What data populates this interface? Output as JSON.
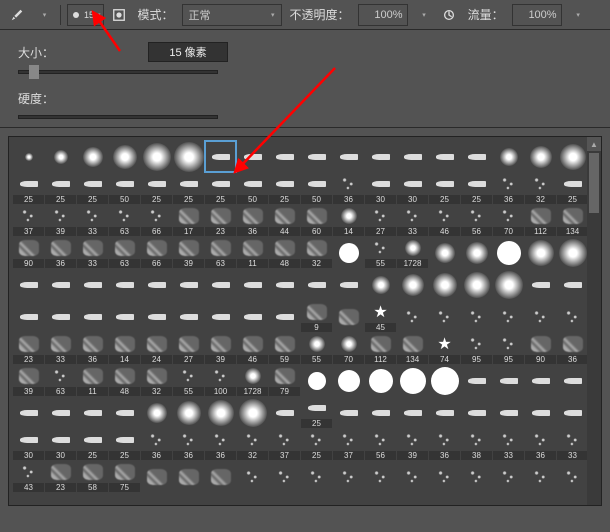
{
  "toolbar": {
    "brush_size_value": "15",
    "mode_label": "模式：",
    "mode_value": "正常",
    "opacity_label": "不透明度：",
    "opacity_value": "100%",
    "flow_label": "流量：",
    "flow_value": "100%"
  },
  "panel": {
    "size_label": "大小：",
    "size_value": "15 像素",
    "hardness_label": "硬度："
  },
  "brushes": [
    {
      "label": "",
      "type": "soft-round",
      "size": 8
    },
    {
      "label": "",
      "type": "soft-round",
      "size": 14
    },
    {
      "label": "",
      "type": "soft-round",
      "size": 20
    },
    {
      "label": "",
      "type": "soft-round",
      "size": 24
    },
    {
      "label": "",
      "type": "soft-round",
      "size": 28
    },
    {
      "label": "",
      "type": "soft-round",
      "size": 30
    },
    {
      "label": "",
      "type": "stroke-shape",
      "size": 14,
      "selected": true
    },
    {
      "label": "",
      "type": "stroke-shape",
      "size": 16
    },
    {
      "label": "",
      "type": "stroke-shape",
      "size": 14
    },
    {
      "label": "",
      "type": "stroke-shape",
      "size": 12
    },
    {
      "label": "",
      "type": "stroke-shape",
      "size": 14
    },
    {
      "label": "",
      "type": "stroke-shape",
      "size": 14
    },
    {
      "label": "",
      "type": "stroke-shape",
      "size": 10
    },
    {
      "label": "",
      "type": "stroke-shape",
      "size": 12
    },
    {
      "label": "",
      "type": "stroke-shape",
      "size": 10
    },
    {
      "label": "",
      "type": "soft-round",
      "size": 18
    },
    {
      "label": "",
      "type": "soft-round",
      "size": 22
    },
    {
      "label": "",
      "type": "soft-round",
      "size": 26
    },
    {
      "label": "25",
      "type": "stroke-shape"
    },
    {
      "label": "25",
      "type": "stroke-shape"
    },
    {
      "label": "25",
      "type": "stroke-shape"
    },
    {
      "label": "50",
      "type": "stroke-shape"
    },
    {
      "label": "25",
      "type": "stroke-shape"
    },
    {
      "label": "25",
      "type": "stroke-shape"
    },
    {
      "label": "25",
      "type": "stroke-shape"
    },
    {
      "label": "50",
      "type": "stroke-shape"
    },
    {
      "label": "25",
      "type": "stroke-shape"
    },
    {
      "label": "50",
      "type": "stroke-shape"
    },
    {
      "label": "36",
      "type": "spatter"
    },
    {
      "label": "30",
      "type": "stroke-shape"
    },
    {
      "label": "30",
      "type": "stroke-shape"
    },
    {
      "label": "25",
      "type": "stroke-shape"
    },
    {
      "label": "25",
      "type": "stroke-shape"
    },
    {
      "label": "36",
      "type": "spatter"
    },
    {
      "label": "32",
      "type": "spatter"
    },
    {
      "label": "25",
      "type": "stroke-shape"
    },
    {
      "label": "37",
      "type": "spatter"
    },
    {
      "label": "39",
      "type": "spatter"
    },
    {
      "label": "33",
      "type": "spatter"
    },
    {
      "label": "63",
      "type": "spatter"
    },
    {
      "label": "66",
      "type": "spatter"
    },
    {
      "label": "17",
      "type": "chalk"
    },
    {
      "label": "23",
      "type": "chalk"
    },
    {
      "label": "36",
      "type": "chalk"
    },
    {
      "label": "44",
      "type": "chalk"
    },
    {
      "label": "60",
      "type": "chalk"
    },
    {
      "label": "14",
      "type": "soft-round"
    },
    {
      "label": "27",
      "type": "spatter"
    },
    {
      "label": "33",
      "type": "spatter"
    },
    {
      "label": "46",
      "type": "spatter"
    },
    {
      "label": "56",
      "type": "spatter"
    },
    {
      "label": "70",
      "type": "spatter"
    },
    {
      "label": "112",
      "type": "chalk"
    },
    {
      "label": "134",
      "type": "chalk"
    },
    {
      "label": "90",
      "type": "chalk"
    },
    {
      "label": "36",
      "type": "chalk"
    },
    {
      "label": "33",
      "type": "chalk"
    },
    {
      "label": "63",
      "type": "chalk"
    },
    {
      "label": "66",
      "type": "chalk"
    },
    {
      "label": "39",
      "type": "chalk"
    },
    {
      "label": "63",
      "type": "chalk"
    },
    {
      "label": "11",
      "type": "chalk"
    },
    {
      "label": "48",
      "type": "chalk"
    },
    {
      "label": "32",
      "type": "chalk"
    },
    {
      "label": "",
      "type": "hard-round",
      "size": 20
    },
    {
      "label": "55",
      "type": "spatter"
    },
    {
      "label": "1728",
      "type": "soft-round"
    },
    {
      "label": "",
      "type": "soft-round",
      "size": 20
    },
    {
      "label": "",
      "type": "soft-round",
      "size": 22
    },
    {
      "label": "",
      "type": "hard-round",
      "size": 24
    },
    {
      "label": "",
      "type": "soft-round",
      "size": 26
    },
    {
      "label": "",
      "type": "soft-round",
      "size": 28
    },
    {
      "label": "",
      "type": "stroke-shape"
    },
    {
      "label": "",
      "type": "stroke-shape"
    },
    {
      "label": "",
      "type": "stroke-shape"
    },
    {
      "label": "",
      "type": "stroke-shape"
    },
    {
      "label": "",
      "type": "stroke-shape"
    },
    {
      "label": "",
      "type": "stroke-shape"
    },
    {
      "label": "",
      "type": "stroke-shape"
    },
    {
      "label": "",
      "type": "stroke-shape"
    },
    {
      "label": "",
      "type": "stroke-shape"
    },
    {
      "label": "",
      "type": "stroke-shape"
    },
    {
      "label": "",
      "type": "stroke-shape"
    },
    {
      "label": "",
      "type": "soft-round",
      "size": 18
    },
    {
      "label": "",
      "type": "soft-round",
      "size": 22
    },
    {
      "label": "",
      "type": "soft-round",
      "size": 24
    },
    {
      "label": "",
      "type": "soft-round",
      "size": 26
    },
    {
      "label": "",
      "type": "soft-round",
      "size": 28
    },
    {
      "label": "",
      "type": "stroke-shape"
    },
    {
      "label": "",
      "type": "stroke-shape"
    },
    {
      "label": "",
      "type": "stroke-shape"
    },
    {
      "label": "",
      "type": "stroke-shape"
    },
    {
      "label": "",
      "type": "stroke-shape"
    },
    {
      "label": "",
      "type": "stroke-shape"
    },
    {
      "label": "",
      "type": "stroke-shape"
    },
    {
      "label": "",
      "type": "stroke-shape"
    },
    {
      "label": "",
      "type": "stroke-shape"
    },
    {
      "label": "",
      "type": "stroke-shape"
    },
    {
      "label": "",
      "type": "stroke-shape"
    },
    {
      "label": "9",
      "type": "chalk"
    },
    {
      "label": "",
      "type": "chalk"
    },
    {
      "label": "45",
      "type": "star"
    },
    {
      "label": "",
      "type": "spatter"
    },
    {
      "label": "",
      "type": "spatter"
    },
    {
      "label": "",
      "type": "spatter"
    },
    {
      "label": "",
      "type": "spatter"
    },
    {
      "label": "",
      "type": "spatter"
    },
    {
      "label": "",
      "type": "spatter"
    },
    {
      "label": "23",
      "type": "chalk"
    },
    {
      "label": "33",
      "type": "chalk"
    },
    {
      "label": "36",
      "type": "chalk"
    },
    {
      "label": "14",
      "type": "chalk"
    },
    {
      "label": "24",
      "type": "chalk"
    },
    {
      "label": "27",
      "type": "chalk"
    },
    {
      "label": "39",
      "type": "chalk"
    },
    {
      "label": "46",
      "type": "chalk"
    },
    {
      "label": "59",
      "type": "chalk"
    },
    {
      "label": "55",
      "type": "soft-round"
    },
    {
      "label": "70",
      "type": "soft-round"
    },
    {
      "label": "112",
      "type": "chalk"
    },
    {
      "label": "134",
      "type": "chalk"
    },
    {
      "label": "74",
      "type": "star"
    },
    {
      "label": "95",
      "type": "spatter"
    },
    {
      "label": "95",
      "type": "spatter"
    },
    {
      "label": "90",
      "type": "chalk"
    },
    {
      "label": "36",
      "type": "chalk"
    },
    {
      "label": "39",
      "type": "chalk"
    },
    {
      "label": "63",
      "type": "spatter"
    },
    {
      "label": "11",
      "type": "chalk"
    },
    {
      "label": "48",
      "type": "chalk"
    },
    {
      "label": "32",
      "type": "chalk"
    },
    {
      "label": "55",
      "type": "spatter"
    },
    {
      "label": "100",
      "type": "spatter"
    },
    {
      "label": "1728",
      "type": "soft-round"
    },
    {
      "label": "79",
      "type": "chalk"
    },
    {
      "label": "",
      "type": "hard-round",
      "size": 18
    },
    {
      "label": "",
      "type": "hard-round",
      "size": 22
    },
    {
      "label": "",
      "type": "hard-round",
      "size": 24
    },
    {
      "label": "",
      "type": "hard-round",
      "size": 26
    },
    {
      "label": "",
      "type": "hard-round",
      "size": 28
    },
    {
      "label": "",
      "type": "stroke-shape"
    },
    {
      "label": "",
      "type": "stroke-shape"
    },
    {
      "label": "",
      "type": "stroke-shape"
    },
    {
      "label": "",
      "type": "stroke-shape"
    },
    {
      "label": "",
      "type": "stroke-shape"
    },
    {
      "label": "",
      "type": "stroke-shape"
    },
    {
      "label": "",
      "type": "stroke-shape"
    },
    {
      "label": "",
      "type": "stroke-shape"
    },
    {
      "label": "",
      "type": "soft-round",
      "size": 20
    },
    {
      "label": "",
      "type": "soft-round",
      "size": 24
    },
    {
      "label": "",
      "type": "soft-round",
      "size": 26
    },
    {
      "label": "",
      "type": "soft-round",
      "size": 28
    },
    {
      "label": "",
      "type": "stroke-shape"
    },
    {
      "label": "25",
      "type": "stroke-shape"
    },
    {
      "label": "",
      "type": "stroke-shape"
    },
    {
      "label": "",
      "type": "stroke-shape"
    },
    {
      "label": "",
      "type": "stroke-shape"
    },
    {
      "label": "",
      "type": "stroke-shape"
    },
    {
      "label": "",
      "type": "stroke-shape"
    },
    {
      "label": "",
      "type": "stroke-shape"
    },
    {
      "label": "",
      "type": "stroke-shape"
    },
    {
      "label": "",
      "type": "stroke-shape"
    },
    {
      "label": "30",
      "type": "stroke-shape"
    },
    {
      "label": "30",
      "type": "stroke-shape"
    },
    {
      "label": "25",
      "type": "stroke-shape"
    },
    {
      "label": "25",
      "type": "stroke-shape"
    },
    {
      "label": "36",
      "type": "spatter"
    },
    {
      "label": "36",
      "type": "spatter"
    },
    {
      "label": "36",
      "type": "spatter"
    },
    {
      "label": "32",
      "type": "spatter"
    },
    {
      "label": "37",
      "type": "spatter"
    },
    {
      "label": "25",
      "type": "spatter"
    },
    {
      "label": "37",
      "type": "spatter"
    },
    {
      "label": "56",
      "type": "spatter"
    },
    {
      "label": "39",
      "type": "spatter"
    },
    {
      "label": "36",
      "type": "spatter"
    },
    {
      "label": "38",
      "type": "spatter"
    },
    {
      "label": "33",
      "type": "spatter"
    },
    {
      "label": "36",
      "type": "spatter"
    },
    {
      "label": "33",
      "type": "spatter"
    },
    {
      "label": "43",
      "type": "spatter"
    },
    {
      "label": "23",
      "type": "chalk"
    },
    {
      "label": "58",
      "type": "chalk"
    },
    {
      "label": "75",
      "type": "chalk"
    },
    {
      "label": "",
      "type": "chalk"
    },
    {
      "label": "",
      "type": "chalk"
    },
    {
      "label": "",
      "type": "chalk"
    },
    {
      "label": "",
      "type": "spatter"
    },
    {
      "label": "",
      "type": "spatter"
    },
    {
      "label": "",
      "type": "spatter"
    },
    {
      "label": "",
      "type": "spatter"
    },
    {
      "label": "",
      "type": "spatter"
    },
    {
      "label": "",
      "type": "spatter"
    },
    {
      "label": "",
      "type": "spatter"
    },
    {
      "label": "",
      "type": "spatter"
    },
    {
      "label": "",
      "type": "spatter"
    },
    {
      "label": "",
      "type": "spatter"
    },
    {
      "label": "",
      "type": "spatter"
    }
  ]
}
